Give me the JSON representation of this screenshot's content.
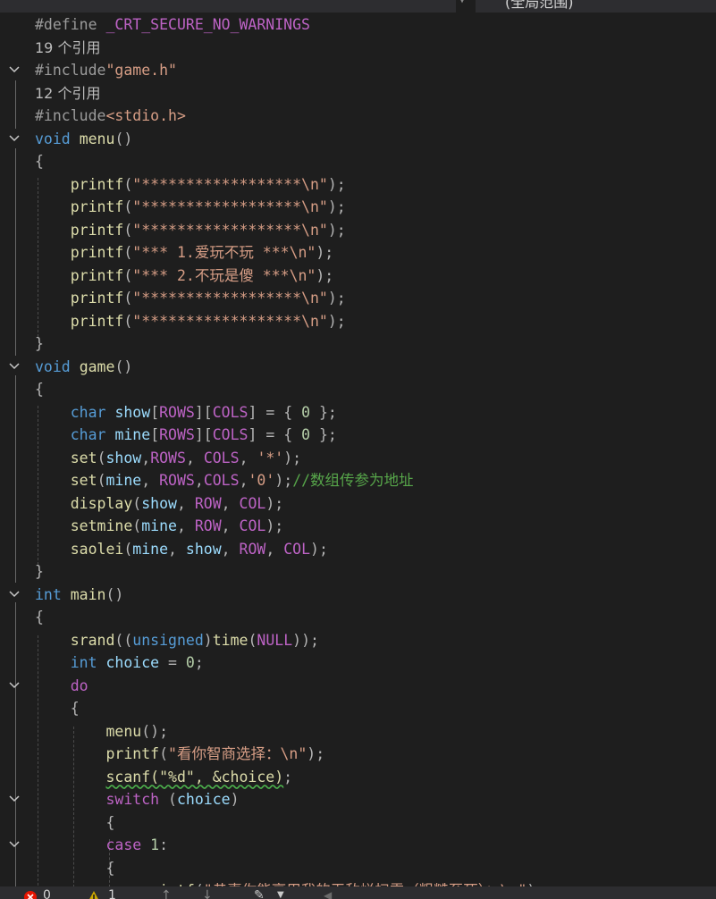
{
  "header": {
    "scope": "(全局范围)"
  },
  "colors": {
    "background": "#1e1e1e",
    "preprocessor": "#9b9b9b",
    "keyword": "#569cd6",
    "function": "#dcdcaa",
    "string": "#d69d85",
    "number": "#b5cea8",
    "variable": "#9cdcfe",
    "macro": "#bd63c5",
    "comment": "#57a64a",
    "punctuation": "#b4b4b4",
    "plain": "#d4d4d4",
    "reference": "#bcbcbc",
    "error_icon": "#e51400",
    "warning_icon": "#cca700"
  },
  "code_lines": [
    {
      "fold": false,
      "tokens": [
        {
          "t": "#define ",
          "c": "preprocessor"
        },
        {
          "t": "_CRT_SECURE_NO_WARNINGS",
          "c": "macro"
        }
      ]
    },
    {
      "fold": false,
      "ref": true,
      "tokens": [
        {
          "t": "19 个引用",
          "c": "reference"
        }
      ]
    },
    {
      "fold": true,
      "tokens": [
        {
          "t": "#include",
          "c": "preprocessor"
        },
        {
          "t": "\"game.h\"",
          "c": "string"
        }
      ]
    },
    {
      "fold": false,
      "ref": true,
      "tokens": [
        {
          "t": "12 个引用",
          "c": "reference"
        }
      ]
    },
    {
      "fold": false,
      "tokens": [
        {
          "t": "#include",
          "c": "preprocessor"
        },
        {
          "t": "<stdio.h>",
          "c": "string"
        }
      ]
    },
    {
      "fold": true,
      "tokens": [
        {
          "t": "void",
          "c": "keyword"
        },
        {
          "t": " ",
          "c": "plain"
        },
        {
          "t": "menu",
          "c": "function"
        },
        {
          "t": "()",
          "c": "punctuation"
        }
      ]
    },
    {
      "fold": false,
      "tokens": [
        {
          "t": "{",
          "c": "punctuation"
        }
      ]
    },
    {
      "fold": false,
      "tokens": [
        {
          "t": "    ",
          "c": "plain"
        },
        {
          "t": "printf",
          "c": "function"
        },
        {
          "t": "(",
          "c": "punctuation"
        },
        {
          "t": "\"******************\\n\"",
          "c": "string"
        },
        {
          "t": ");",
          "c": "punctuation"
        }
      ]
    },
    {
      "fold": false,
      "tokens": [
        {
          "t": "    ",
          "c": "plain"
        },
        {
          "t": "printf",
          "c": "function"
        },
        {
          "t": "(",
          "c": "punctuation"
        },
        {
          "t": "\"******************\\n\"",
          "c": "string"
        },
        {
          "t": ");",
          "c": "punctuation"
        }
      ]
    },
    {
      "fold": false,
      "tokens": [
        {
          "t": "    ",
          "c": "plain"
        },
        {
          "t": "printf",
          "c": "function"
        },
        {
          "t": "(",
          "c": "punctuation"
        },
        {
          "t": "\"******************\\n\"",
          "c": "string"
        },
        {
          "t": ");",
          "c": "punctuation"
        }
      ]
    },
    {
      "fold": false,
      "tokens": [
        {
          "t": "    ",
          "c": "plain"
        },
        {
          "t": "printf",
          "c": "function"
        },
        {
          "t": "(",
          "c": "punctuation"
        },
        {
          "t": "\"*** 1.爱玩不玩 ***\\n\"",
          "c": "string"
        },
        {
          "t": ");",
          "c": "punctuation"
        }
      ]
    },
    {
      "fold": false,
      "tokens": [
        {
          "t": "    ",
          "c": "plain"
        },
        {
          "t": "printf",
          "c": "function"
        },
        {
          "t": "(",
          "c": "punctuation"
        },
        {
          "t": "\"*** 2.不玩是傻 ***\\n\"",
          "c": "string"
        },
        {
          "t": ");",
          "c": "punctuation"
        }
      ]
    },
    {
      "fold": false,
      "tokens": [
        {
          "t": "    ",
          "c": "plain"
        },
        {
          "t": "printf",
          "c": "function"
        },
        {
          "t": "(",
          "c": "punctuation"
        },
        {
          "t": "\"******************\\n\"",
          "c": "string"
        },
        {
          "t": ");",
          "c": "punctuation"
        }
      ]
    },
    {
      "fold": false,
      "tokens": [
        {
          "t": "    ",
          "c": "plain"
        },
        {
          "t": "printf",
          "c": "function"
        },
        {
          "t": "(",
          "c": "punctuation"
        },
        {
          "t": "\"******************\\n\"",
          "c": "string"
        },
        {
          "t": ");",
          "c": "punctuation"
        }
      ]
    },
    {
      "fold": false,
      "tokens": [
        {
          "t": "}",
          "c": "punctuation"
        }
      ]
    },
    {
      "fold": true,
      "tokens": [
        {
          "t": "void",
          "c": "keyword"
        },
        {
          "t": " ",
          "c": "plain"
        },
        {
          "t": "game",
          "c": "function"
        },
        {
          "t": "()",
          "c": "punctuation"
        }
      ]
    },
    {
      "fold": false,
      "tokens": [
        {
          "t": "{",
          "c": "punctuation"
        }
      ]
    },
    {
      "fold": false,
      "tokens": [
        {
          "t": "    ",
          "c": "plain"
        },
        {
          "t": "char",
          "c": "keyword"
        },
        {
          "t": " ",
          "c": "plain"
        },
        {
          "t": "show",
          "c": "variable"
        },
        {
          "t": "[",
          "c": "punctuation"
        },
        {
          "t": "ROWS",
          "c": "macro"
        },
        {
          "t": "][",
          "c": "punctuation"
        },
        {
          "t": "COLS",
          "c": "macro"
        },
        {
          "t": "] = { ",
          "c": "punctuation"
        },
        {
          "t": "0",
          "c": "number"
        },
        {
          "t": " };",
          "c": "punctuation"
        }
      ]
    },
    {
      "fold": false,
      "tokens": [
        {
          "t": "    ",
          "c": "plain"
        },
        {
          "t": "char",
          "c": "keyword"
        },
        {
          "t": " ",
          "c": "plain"
        },
        {
          "t": "mine",
          "c": "variable"
        },
        {
          "t": "[",
          "c": "punctuation"
        },
        {
          "t": "ROWS",
          "c": "macro"
        },
        {
          "t": "][",
          "c": "punctuation"
        },
        {
          "t": "COLS",
          "c": "macro"
        },
        {
          "t": "] = { ",
          "c": "punctuation"
        },
        {
          "t": "0",
          "c": "number"
        },
        {
          "t": " };",
          "c": "punctuation"
        }
      ]
    },
    {
      "fold": false,
      "tokens": [
        {
          "t": "    ",
          "c": "plain"
        },
        {
          "t": "set",
          "c": "function"
        },
        {
          "t": "(",
          "c": "punctuation"
        },
        {
          "t": "show",
          "c": "variable"
        },
        {
          "t": ",",
          "c": "punctuation"
        },
        {
          "t": "ROWS",
          "c": "macro"
        },
        {
          "t": ", ",
          "c": "punctuation"
        },
        {
          "t": "COLS",
          "c": "macro"
        },
        {
          "t": ", ",
          "c": "punctuation"
        },
        {
          "t": "'*'",
          "c": "string"
        },
        {
          "t": ");",
          "c": "punctuation"
        }
      ]
    },
    {
      "fold": false,
      "tokens": [
        {
          "t": "    ",
          "c": "plain"
        },
        {
          "t": "set",
          "c": "function"
        },
        {
          "t": "(",
          "c": "punctuation"
        },
        {
          "t": "mine",
          "c": "variable"
        },
        {
          "t": ", ",
          "c": "punctuation"
        },
        {
          "t": "ROWS",
          "c": "macro"
        },
        {
          "t": ",",
          "c": "punctuation"
        },
        {
          "t": "COLS",
          "c": "macro"
        },
        {
          "t": ",",
          "c": "punctuation"
        },
        {
          "t": "'0'",
          "c": "string"
        },
        {
          "t": ");",
          "c": "punctuation"
        },
        {
          "t": "//数组传参为地址",
          "c": "comment"
        }
      ]
    },
    {
      "fold": false,
      "tokens": [
        {
          "t": "    ",
          "c": "plain"
        },
        {
          "t": "display",
          "c": "function"
        },
        {
          "t": "(",
          "c": "punctuation"
        },
        {
          "t": "show",
          "c": "variable"
        },
        {
          "t": ", ",
          "c": "punctuation"
        },
        {
          "t": "ROW",
          "c": "macro"
        },
        {
          "t": ", ",
          "c": "punctuation"
        },
        {
          "t": "COL",
          "c": "macro"
        },
        {
          "t": ");",
          "c": "punctuation"
        }
      ]
    },
    {
      "fold": false,
      "tokens": [
        {
          "t": "    ",
          "c": "plain"
        },
        {
          "t": "setmine",
          "c": "function"
        },
        {
          "t": "(",
          "c": "punctuation"
        },
        {
          "t": "mine",
          "c": "variable"
        },
        {
          "t": ", ",
          "c": "punctuation"
        },
        {
          "t": "ROW",
          "c": "macro"
        },
        {
          "t": ", ",
          "c": "punctuation"
        },
        {
          "t": "COL",
          "c": "macro"
        },
        {
          "t": ");",
          "c": "punctuation"
        }
      ]
    },
    {
      "fold": false,
      "tokens": [
        {
          "t": "    ",
          "c": "plain"
        },
        {
          "t": "saolei",
          "c": "function"
        },
        {
          "t": "(",
          "c": "punctuation"
        },
        {
          "t": "mine",
          "c": "variable"
        },
        {
          "t": ", ",
          "c": "punctuation"
        },
        {
          "t": "show",
          "c": "variable"
        },
        {
          "t": ", ",
          "c": "punctuation"
        },
        {
          "t": "ROW",
          "c": "macro"
        },
        {
          "t": ", ",
          "c": "punctuation"
        },
        {
          "t": "COL",
          "c": "macro"
        },
        {
          "t": ");",
          "c": "punctuation"
        }
      ]
    },
    {
      "fold": false,
      "tokens": [
        {
          "t": "}",
          "c": "punctuation"
        }
      ]
    },
    {
      "fold": true,
      "tokens": [
        {
          "t": "int",
          "c": "keyword"
        },
        {
          "t": " ",
          "c": "plain"
        },
        {
          "t": "main",
          "c": "function"
        },
        {
          "t": "()",
          "c": "punctuation"
        }
      ]
    },
    {
      "fold": false,
      "tokens": [
        {
          "t": "{",
          "c": "punctuation"
        }
      ]
    },
    {
      "fold": false,
      "tokens": [
        {
          "t": "    ",
          "c": "plain"
        },
        {
          "t": "srand",
          "c": "function"
        },
        {
          "t": "((",
          "c": "punctuation"
        },
        {
          "t": "unsigned",
          "c": "keyword"
        },
        {
          "t": ")",
          "c": "punctuation"
        },
        {
          "t": "time",
          "c": "function"
        },
        {
          "t": "(",
          "c": "punctuation"
        },
        {
          "t": "NULL",
          "c": "macro"
        },
        {
          "t": "));",
          "c": "punctuation"
        }
      ]
    },
    {
      "fold": false,
      "tokens": [
        {
          "t": "    ",
          "c": "plain"
        },
        {
          "t": "int",
          "c": "keyword"
        },
        {
          "t": " ",
          "c": "plain"
        },
        {
          "t": "choice",
          "c": "variable"
        },
        {
          "t": " = ",
          "c": "punctuation"
        },
        {
          "t": "0",
          "c": "number"
        },
        {
          "t": ";",
          "c": "punctuation"
        }
      ]
    },
    {
      "fold": true,
      "tokens": [
        {
          "t": "    ",
          "c": "plain"
        },
        {
          "t": "do",
          "c": "macro"
        }
      ]
    },
    {
      "fold": false,
      "tokens": [
        {
          "t": "    ",
          "c": "plain"
        },
        {
          "t": "{",
          "c": "punctuation"
        }
      ]
    },
    {
      "fold": false,
      "tokens": [
        {
          "t": "        ",
          "c": "plain"
        },
        {
          "t": "menu",
          "c": "function"
        },
        {
          "t": "();",
          "c": "punctuation"
        }
      ]
    },
    {
      "fold": false,
      "tokens": [
        {
          "t": "        ",
          "c": "plain"
        },
        {
          "t": "printf",
          "c": "function"
        },
        {
          "t": "(",
          "c": "punctuation"
        },
        {
          "t": "\"看你智商选择：\\n\"",
          "c": "string"
        },
        {
          "t": ");",
          "c": "punctuation"
        }
      ]
    },
    {
      "fold": false,
      "tokens": [
        {
          "t": "        ",
          "c": "plain"
        },
        {
          "t": "scanf(\"%d\", &choice)",
          "c": "function",
          "sq": true
        },
        {
          "t": ";",
          "c": "punctuation"
        }
      ]
    },
    {
      "fold": true,
      "tokens": [
        {
          "t": "        ",
          "c": "plain"
        },
        {
          "t": "switch",
          "c": "macro"
        },
        {
          "t": " (",
          "c": "punctuation"
        },
        {
          "t": "choice",
          "c": "variable"
        },
        {
          "t": ")",
          "c": "punctuation"
        }
      ]
    },
    {
      "fold": false,
      "tokens": [
        {
          "t": "        ",
          "c": "plain"
        },
        {
          "t": "{",
          "c": "punctuation"
        }
      ]
    },
    {
      "fold": true,
      "tokens": [
        {
          "t": "        ",
          "c": "plain"
        },
        {
          "t": "case",
          "c": "macro"
        },
        {
          "t": " ",
          "c": "plain"
        },
        {
          "t": "1",
          "c": "number"
        },
        {
          "t": ":",
          "c": "punctuation"
        }
      ]
    },
    {
      "fold": false,
      "tokens": [
        {
          "t": "        ",
          "c": "plain"
        },
        {
          "t": "{",
          "c": "punctuation"
        }
      ]
    },
    {
      "fold": false,
      "tokens": [
        {
          "t": "            ",
          "c": "plain"
        },
        {
          "t": "printf",
          "c": "function"
        },
        {
          "t": "(",
          "c": "punctuation"
        },
        {
          "t": "\"恭喜你能享用我的无敌烂扫雷（粗糙至死）：\\n\"",
          "c": "string"
        },
        {
          "t": ");",
          "c": "punctuation"
        }
      ]
    }
  ],
  "status": {
    "errors": "0",
    "warnings": "1"
  }
}
